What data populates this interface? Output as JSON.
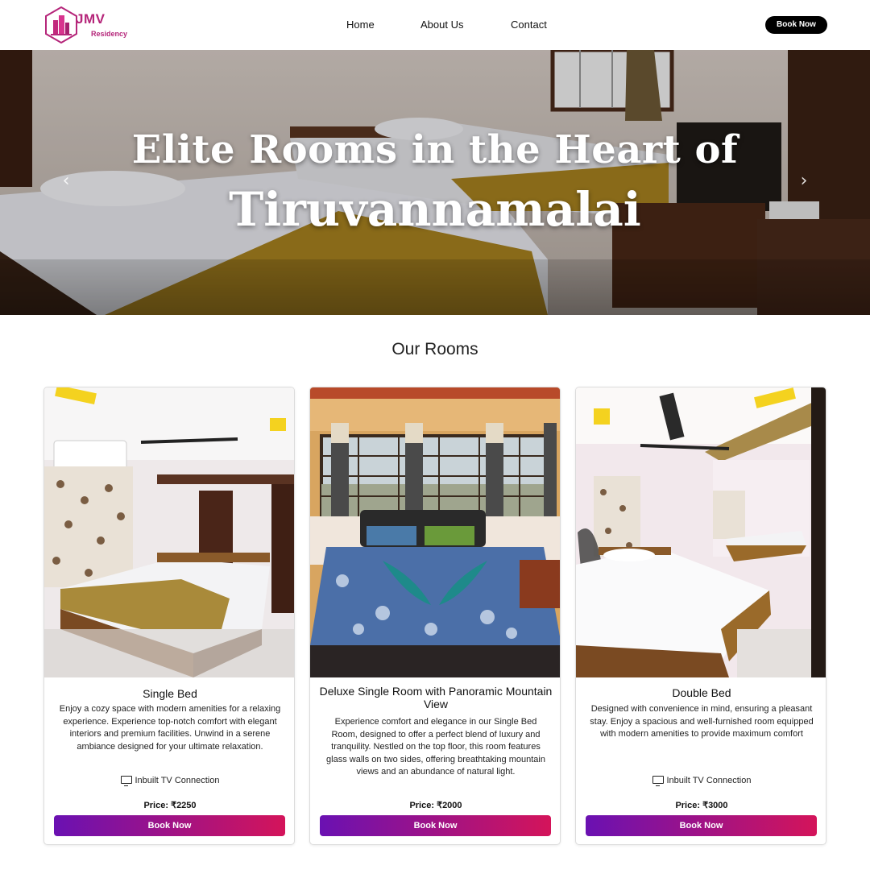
{
  "header": {
    "logo_name": "JMV",
    "logo_sub": "Residency",
    "nav": [
      "Home",
      "About Us",
      "Contact"
    ],
    "book_label": "Book Now"
  },
  "hero": {
    "line1": "Elite Rooms in the Heart of",
    "line2": "Tiruvannamalai",
    "prev_icon": "chevron-left-icon",
    "next_icon": "chevron-right-icon"
  },
  "section": {
    "title": "Our Rooms"
  },
  "rooms": [
    {
      "title": "Single Bed",
      "description": "Enjoy a cozy space with modern amenities for a relaxing experience. Experience top-notch comfort with elegant interiors and premium facilities. Unwind in a serene ambiance designed for your ultimate relaxation.",
      "feature": "Inbuilt TV Connection",
      "price": "Price: ₹2250",
      "button": "Book Now"
    },
    {
      "title": "Deluxe Single Room with Panoramic Mountain View",
      "description": "Experience comfort and elegance in our Single Bed Room, designed to offer a perfect blend of luxury and tranquility. Nestled on the top floor, this room features glass walls on two sides, offering breathtaking mountain views and an abundance of natural light.",
      "price": "Price: ₹2000",
      "button": "Book Now"
    },
    {
      "title": "Double Bed",
      "description": "Designed with convenience in mind, ensuring a pleasant stay. Enjoy a spacious and well-furnished room equipped with modern amenities to provide maximum comfort",
      "feature": "Inbuilt TV Connection",
      "price": "Price: ₹3000",
      "button": "Book Now"
    }
  ],
  "colors": {
    "brand": "#b5267a",
    "button_start": "#6a11b2",
    "button_end": "#d4145a"
  }
}
